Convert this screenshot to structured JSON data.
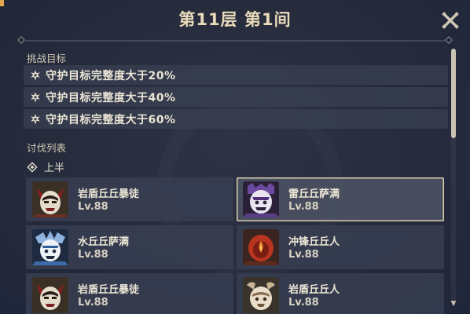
{
  "header": {
    "title": "第11层 第1间"
  },
  "goals": {
    "label": "挑战目标",
    "items": [
      {
        "text": "守护目标完整度大于20%"
      },
      {
        "text": "守护目标完整度大于40%"
      },
      {
        "text": "守护目标完整度大于60%"
      }
    ]
  },
  "enemy_list": {
    "label": "讨伐列表",
    "half_label": "上半",
    "enemies": [
      {
        "name": "岩盾丘丘暴徒",
        "level": "Lv.88",
        "icon": "hilichurl-mitachurl-portrait",
        "selected": false
      },
      {
        "name": "雷丘丘萨满",
        "level": "Lv.88",
        "icon": "electro-samachurl-portrait",
        "selected": true
      },
      {
        "name": "水丘丘萨满",
        "level": "Lv.88",
        "icon": "hydro-samachurl-portrait",
        "selected": false
      },
      {
        "name": "冲锋丘丘人",
        "level": "Lv.88",
        "icon": "hilichurl-berserker-portrait",
        "selected": false
      },
      {
        "name": "岩盾丘丘暴徒",
        "level": "Lv.88",
        "icon": "hilichurl-mitachurl-portrait",
        "selected": false
      },
      {
        "name": "岩盾丘丘人",
        "level": "Lv.88",
        "icon": "hilichurl-shield-portrait",
        "selected": false
      }
    ]
  },
  "colors": {
    "title": "#e9dcbb",
    "card_bg": "#3a4052",
    "selected_border": "#d9cfae",
    "accent_corner": "#e0a64a"
  }
}
